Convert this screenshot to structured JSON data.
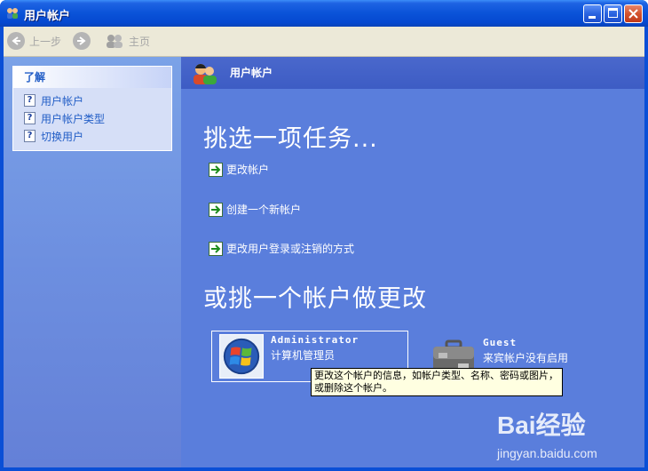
{
  "window": {
    "title": "用户帐户"
  },
  "toolbar": {
    "back_label": "上一步",
    "home_label": "主页"
  },
  "learn": {
    "heading": "了解",
    "items": [
      {
        "label": "用户帐户"
      },
      {
        "label": "用户帐户类型"
      },
      {
        "label": "切换用户"
      }
    ]
  },
  "header": {
    "title": "用户帐户"
  },
  "tasks": {
    "heading": "挑选一项任务...",
    "items": [
      {
        "label": "更改帐户"
      },
      {
        "label": "创建一个新帐户"
      },
      {
        "label": "更改用户登录或注销的方式"
      }
    ]
  },
  "accounts": {
    "heading": "或挑一个帐户做更改",
    "items": [
      {
        "name": "Administrator",
        "desc": "计算机管理员"
      },
      {
        "name": "Guest",
        "desc": "来宾帐户没有启用"
      }
    ]
  },
  "tooltip": {
    "text": "更改这个帐户的信息，如帐户类型、名称、密码或图片，或删除这个帐户。"
  },
  "watermark": {
    "brand": "Bai经验",
    "url": "jingyan.baidu.com"
  },
  "colors": {
    "title_bar": "#0a53d8",
    "task_pane": "#5a7edc",
    "left_pane": "#7ba2e7",
    "link": "#215dc6"
  }
}
